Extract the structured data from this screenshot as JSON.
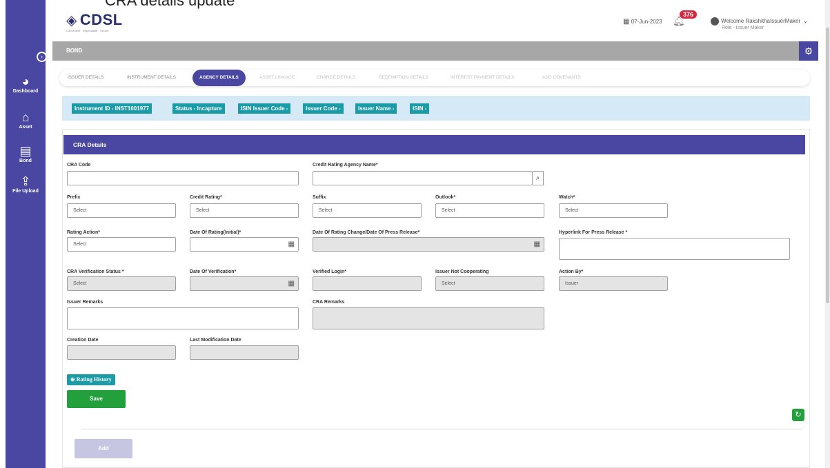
{
  "caption": "CRA details update",
  "sidebar": {
    "items": [
      {
        "icon": "dashboard-icon",
        "label": "Dashboard"
      },
      {
        "icon": "home-icon",
        "label": "Asset"
      },
      {
        "icon": "id-card-icon",
        "label": "Bond"
      },
      {
        "icon": "upload-icon",
        "label": "File Upload"
      }
    ]
  },
  "header": {
    "logo_text": "CDSL",
    "logo_tagline": "Convenient · Dependable · Secure",
    "date": "07-Jun-2023",
    "notification_count": "376",
    "welcome": "Welcome RakshithaIssuerMaker",
    "role": "Role - Issuer Maker"
  },
  "module_title": "BOND",
  "tabs": [
    {
      "label": "ISSUER DETAILS",
      "state": "normal"
    },
    {
      "label": "INSTRUMENT DETAILS",
      "state": "normal"
    },
    {
      "label": "AGENCY DETAILS",
      "state": "active"
    },
    {
      "label": "ASSET LINKAGE",
      "state": "disabled"
    },
    {
      "label": "CHARGE DETAILS",
      "state": "disabled"
    },
    {
      "label": "REDEMPTION DETAILS",
      "state": "disabled"
    },
    {
      "label": "INTEREST PAYMENT DETAILS",
      "state": "disabled"
    },
    {
      "label": "ADD COVENANTS",
      "state": "disabled"
    }
  ],
  "info_chips": [
    "Instrument ID - INST1001977",
    "Status - Incapture",
    "ISIN Issuer Code -",
    "Issuer Code -",
    "Issuer Name -",
    "ISIN -"
  ],
  "section_title": "CRA Details",
  "fields": {
    "cra_code": {
      "label": "CRA Code",
      "value": ""
    },
    "credit_rating_agency_name": {
      "label": "Credit Rating Agency Name*",
      "value": ""
    },
    "prefix": {
      "label": "Prefix",
      "value": "Select"
    },
    "credit_rating": {
      "label": "Credit Rating*",
      "value": "Select"
    },
    "suffix": {
      "label": "Suffix",
      "value": "Select"
    },
    "outlook": {
      "label": "Outlook*",
      "value": "Select"
    },
    "watch": {
      "label": "Watch*",
      "value": "Select"
    },
    "rating_action": {
      "label": "Rating Action*",
      "value": "Select"
    },
    "date_of_rating_initial": {
      "label": "Date Of Rating(Initial)*",
      "value": ""
    },
    "date_of_rating_change": {
      "label": "Date Of Rating Change/Date Of Press Release*",
      "value": ""
    },
    "hyperlink_press_release": {
      "label": "Hyperlink For Press Release *",
      "value": ""
    },
    "cra_verification_status": {
      "label": "CRA Verification Status *",
      "value": "Select"
    },
    "date_of_verification": {
      "label": "Date Of Verification*",
      "value": ""
    },
    "verified_login": {
      "label": "Verified Login*",
      "value": ""
    },
    "issuer_not_cooperating": {
      "label": "Issuer Not Cooperating",
      "value": "Select"
    },
    "action_by": {
      "label": "Action By*",
      "value": "Issuer"
    },
    "issuer_remarks": {
      "label": "Issuer Remarks",
      "value": ""
    },
    "cra_remarks": {
      "label": "CRA Remarks",
      "value": ""
    },
    "creation_date": {
      "label": "Creation Date",
      "value": ""
    },
    "last_modification_date": {
      "label": "Last Modification Date",
      "value": ""
    }
  },
  "buttons": {
    "rating_history": "Rating History",
    "save": "Save",
    "add": "Add"
  },
  "colors": {
    "brand_purple": "#4a47a3",
    "teal_chip": "#1a9ba6",
    "save_green": "#23a03b",
    "info_bg": "#d5e9f7",
    "badge_red": "#d7263d"
  }
}
